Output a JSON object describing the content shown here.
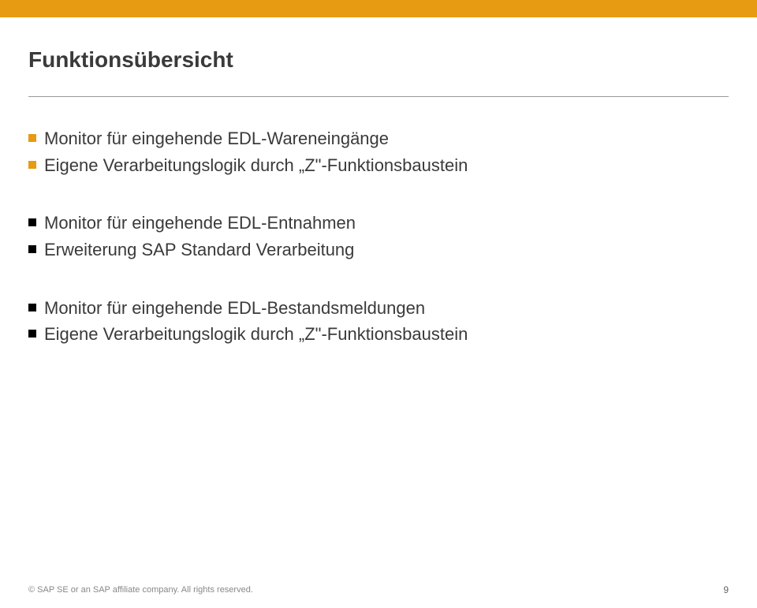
{
  "title": "Funktionsübersicht",
  "groups": [
    {
      "items": [
        {
          "text": "Monitor für eingehende EDL-Wareneingänge",
          "color": "orange"
        },
        {
          "text": "Eigene Verarbeitungslogik durch „Z\"-Funktionsbaustein",
          "color": "orange"
        }
      ]
    },
    {
      "items": [
        {
          "text": "Monitor für eingehende EDL-Entnahmen",
          "color": "black"
        },
        {
          "text": "Erweiterung SAP Standard Verarbeitung",
          "color": "black"
        }
      ]
    },
    {
      "items": [
        {
          "text": "Monitor für eingehende EDL-Bestandsmeldungen",
          "color": "black"
        },
        {
          "text": "Eigene Verarbeitungslogik durch „Z\"-Funktionsbaustein",
          "color": "black"
        }
      ]
    }
  ],
  "footer": {
    "copyright": "© SAP SE or an SAP affiliate company. All rights reserved.",
    "page": "9"
  }
}
